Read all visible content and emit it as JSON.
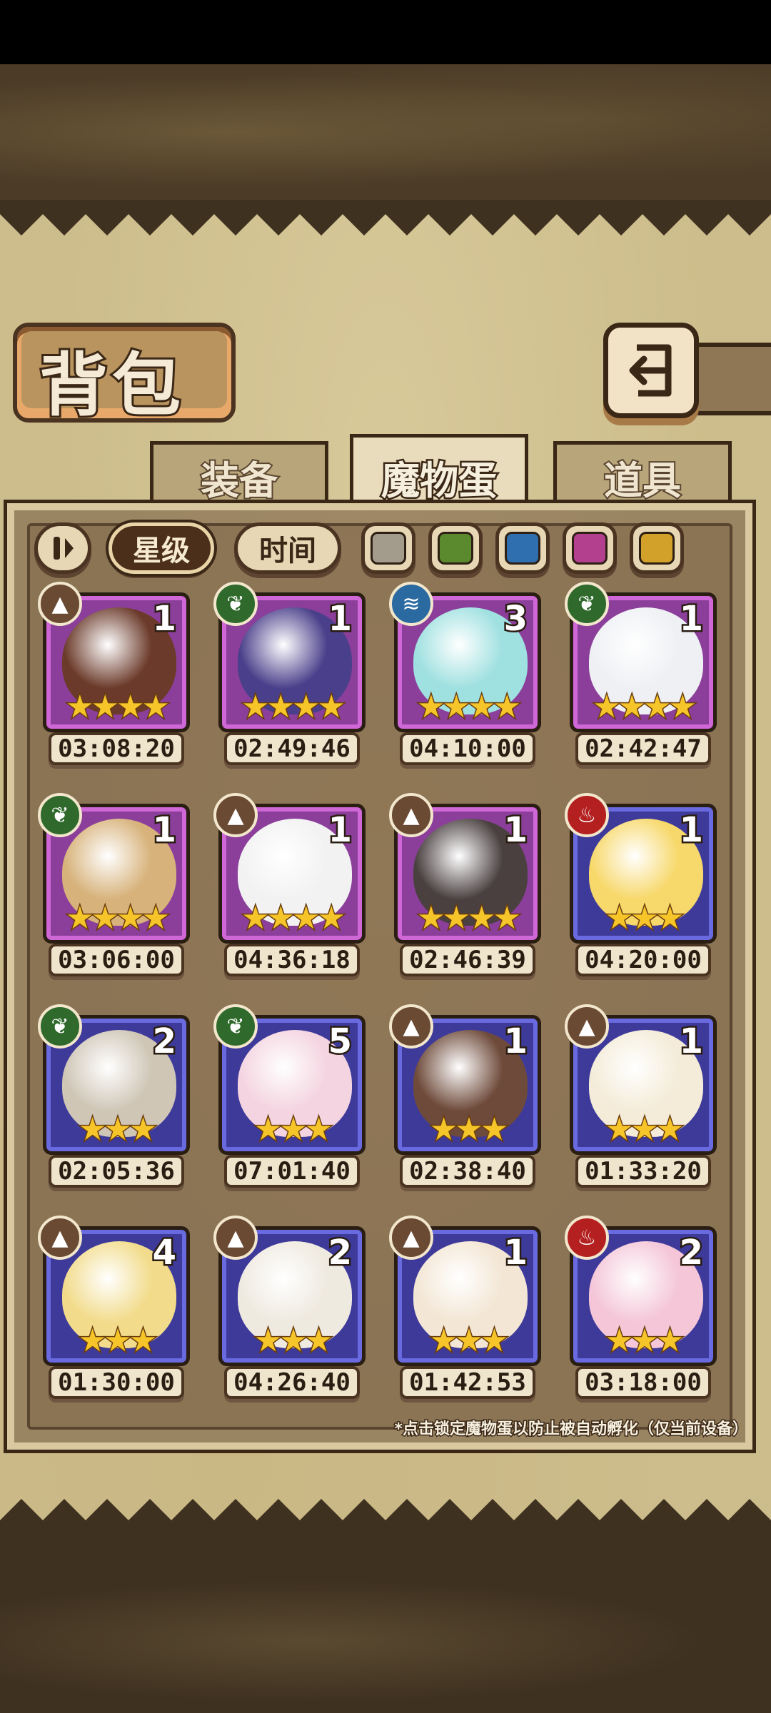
{
  "header": {
    "title": "背包",
    "back_icon": "return-arrow-icon"
  },
  "tabs": [
    {
      "label": "装备",
      "active": false
    },
    {
      "label": "魔物蛋",
      "active": true
    },
    {
      "label": "道具",
      "active": false
    }
  ],
  "filters": {
    "pause_icon": "pause-icon",
    "sort_star": "星级",
    "sort_time": "时间",
    "sort_selected": "星级",
    "colors": [
      "#a39b8b",
      "#5b8a2e",
      "#2f6fb0",
      "#b3408f",
      "#d1a12a"
    ]
  },
  "eggs": [
    {
      "element": "earth",
      "count": "1",
      "stars": 4,
      "rarity": "purple",
      "time": "03:08:20",
      "art": "#6b3a2a"
    },
    {
      "element": "leaf",
      "count": "1",
      "stars": 4,
      "rarity": "purple",
      "time": "02:49:46",
      "art": "#4a3f8a"
    },
    {
      "element": "water",
      "count": "3",
      "stars": 4,
      "rarity": "purple",
      "time": "04:10:00",
      "art": "#9fe0e0"
    },
    {
      "element": "leaf",
      "count": "1",
      "stars": 4,
      "rarity": "purple",
      "time": "02:42:47",
      "art": "#eef0f4"
    },
    {
      "element": "leaf",
      "count": "1",
      "stars": 4,
      "rarity": "purple",
      "time": "03:06:00",
      "art": "#d7b27a"
    },
    {
      "element": "earth",
      "count": "1",
      "stars": 4,
      "rarity": "purple",
      "time": "04:36:18",
      "art": "#f2f2f2"
    },
    {
      "element": "earth",
      "count": "1",
      "stars": 4,
      "rarity": "purple",
      "time": "02:46:39",
      "art": "#4a4040"
    },
    {
      "element": "fire",
      "count": "1",
      "stars": 3,
      "rarity": "blue",
      "time": "04:20:00",
      "art": "#f7d86a"
    },
    {
      "element": "leaf",
      "count": "2",
      "stars": 3,
      "rarity": "blue",
      "time": "02:05:36",
      "art": "#cfc6b6"
    },
    {
      "element": "leaf",
      "count": "5",
      "stars": 3,
      "rarity": "blue",
      "time": "07:01:40",
      "art": "#f4d4e0"
    },
    {
      "element": "earth",
      "count": "1",
      "stars": 3,
      "rarity": "blue",
      "time": "02:38:40",
      "art": "#6e4a3a"
    },
    {
      "element": "earth",
      "count": "1",
      "stars": 3,
      "rarity": "blue",
      "time": "01:33:20",
      "art": "#f4ecd9"
    },
    {
      "element": "earth",
      "count": "4",
      "stars": 3,
      "rarity": "blue",
      "time": "01:30:00",
      "art": "#f2dc8c"
    },
    {
      "element": "earth",
      "count": "2",
      "stars": 3,
      "rarity": "blue",
      "time": "04:26:40",
      "art": "#efeae0"
    },
    {
      "element": "earth",
      "count": "1",
      "stars": 3,
      "rarity": "blue",
      "time": "01:42:53",
      "art": "#f3e6d4"
    },
    {
      "element": "fire",
      "count": "2",
      "stars": 3,
      "rarity": "blue",
      "time": "03:18:00",
      "art": "#f4c6d8"
    }
  ],
  "footnote": "*点击锁定魔物蛋以防止被自动孵化（仅当前设备）"
}
